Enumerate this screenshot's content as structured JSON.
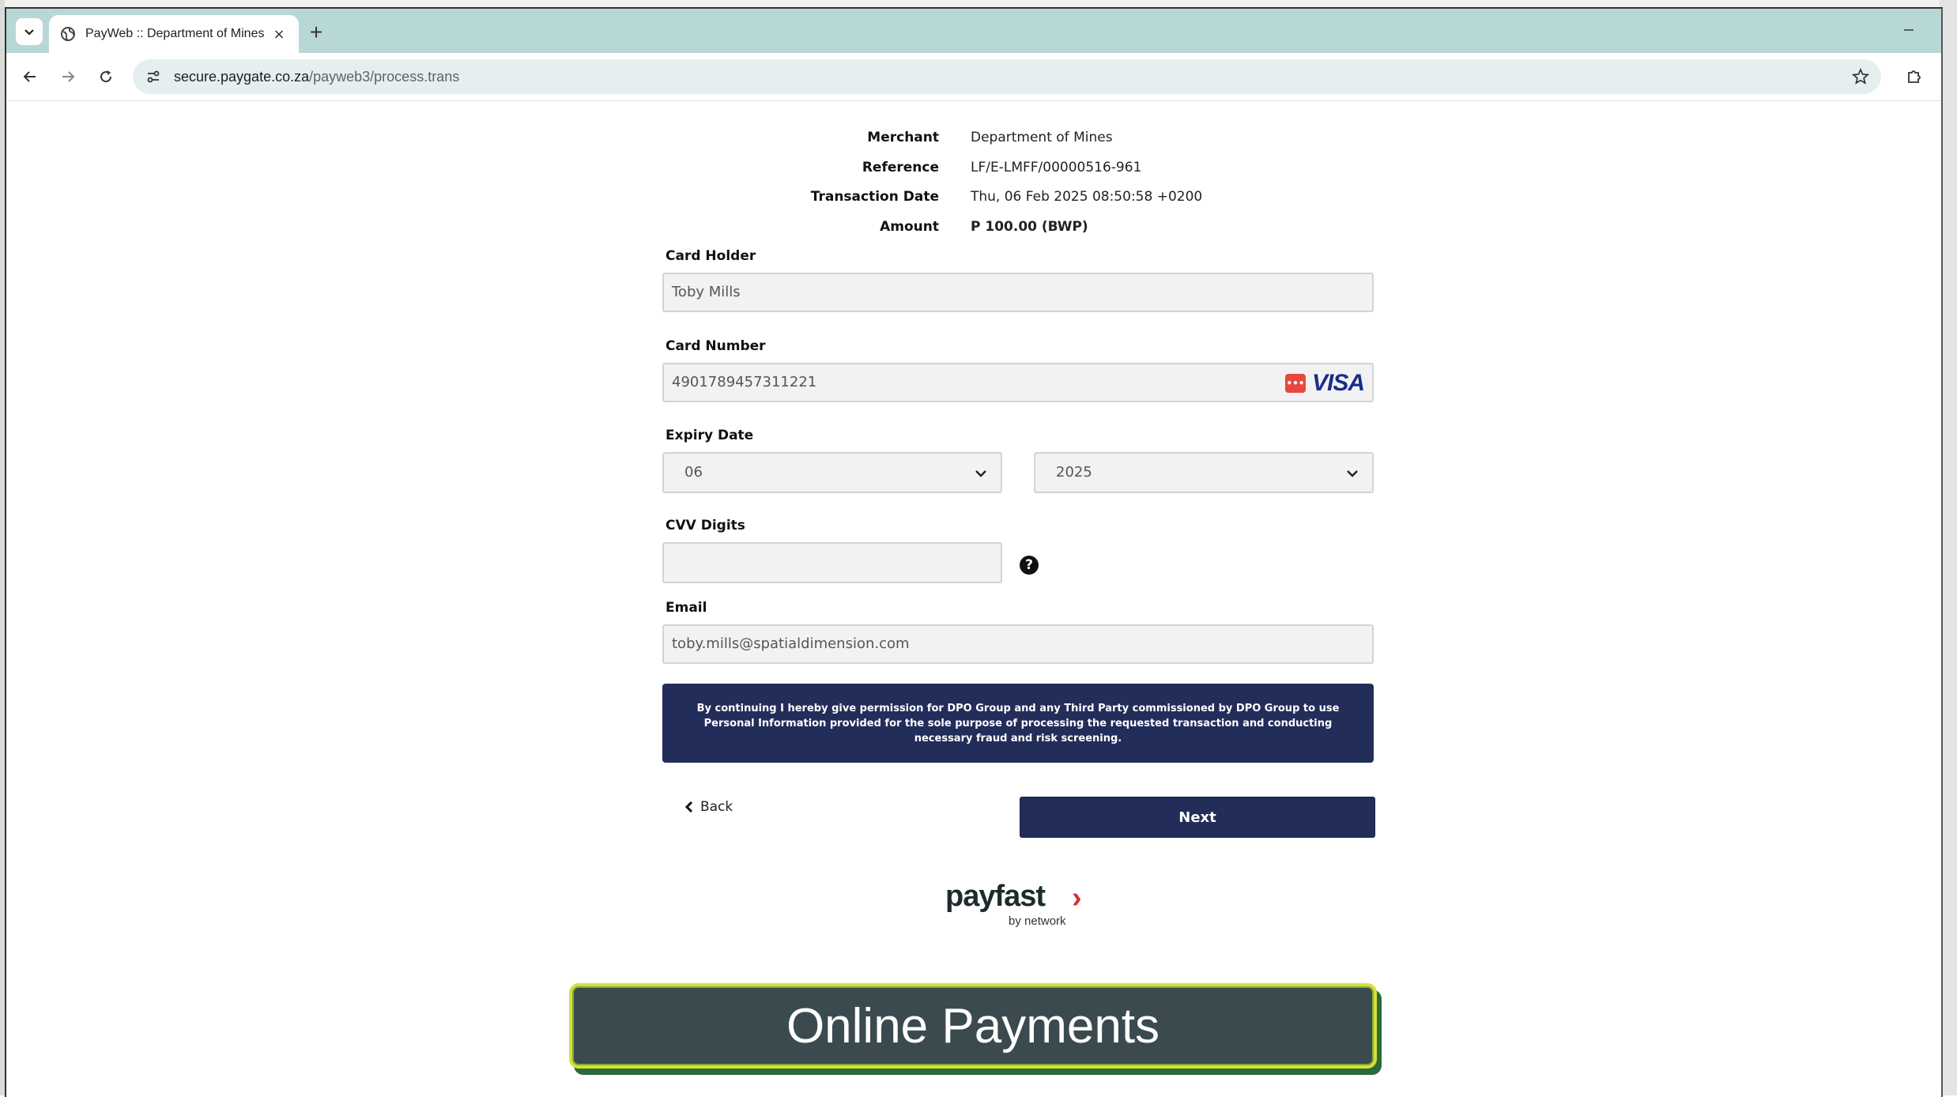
{
  "browser": {
    "tab_title": "PayWeb :: Department of Mines",
    "new_tab_glyph": "+",
    "close_glyph": "×",
    "url_host": "secure.paygate.co.za",
    "url_path": "/payweb3/process.trans"
  },
  "summary": {
    "merchant_label": "Merchant",
    "merchant_value": "Department of Mines",
    "reference_label": "Reference",
    "reference_value": "LF/E-LMFF/00000516-961",
    "date_label": "Transaction Date",
    "date_value": "Thu, 06 Feb 2025 08:50:58 +0200",
    "amount_label": "Amount",
    "amount_value": "P 100.00 (BWP)"
  },
  "form": {
    "card_holder_label": "Card Holder",
    "card_holder_value": "Toby Mills",
    "card_number_label": "Card Number",
    "card_number_value": "4901789457311221",
    "card_brand": "VISA",
    "expiry_label": "Expiry Date",
    "expiry_month": "06",
    "expiry_year": "2025",
    "cvv_label": "CVV Digits",
    "cvv_value": "",
    "help_glyph": "?",
    "email_label": "Email",
    "email_value": "toby.mills@spatialdimension.com"
  },
  "consent_text": "By continuing I hereby give permission for DPO Group and any Third Party commissioned by DPO Group to use Personal Information provided for the sole purpose of processing the requested transaction and conducting necessary fraud and risk screening.",
  "actions": {
    "back_label": "Back",
    "next_label": "Next"
  },
  "logo": {
    "word": "payfast",
    "chevron": "›",
    "sub": "by network"
  },
  "caption": "Online Payments",
  "colors": {
    "brand_navy": "#232d5a",
    "tabbar": "#b8d8d7",
    "logo_red": "#d0333c",
    "caption_bg": "#3b4a4f",
    "caption_border": "#d8e035"
  },
  "icons": [
    "chevron-down-icon",
    "globe-icon",
    "close-icon",
    "back-arrow-icon",
    "forward-arrow-icon",
    "reload-icon",
    "site-settings-icon",
    "star-icon",
    "extensions-icon",
    "minimize-icon",
    "help-icon",
    "chevron-left-icon"
  ]
}
